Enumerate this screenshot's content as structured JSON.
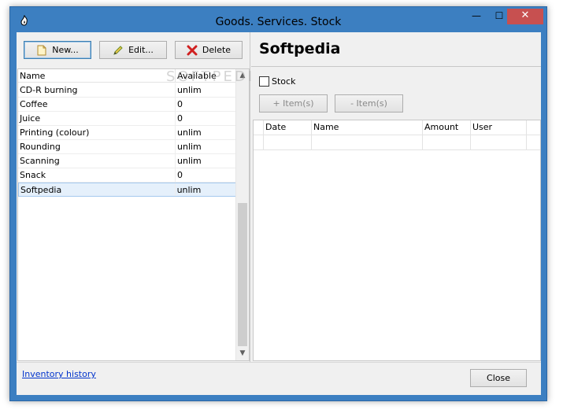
{
  "window": {
    "title": "Goods. Services. Stock",
    "minimize_glyph": "—",
    "maximize_glyph": "☐",
    "close_glyph": "✕"
  },
  "toolbar": {
    "new_label": "New...",
    "edit_label": "Edit...",
    "delete_label": "Delete"
  },
  "items_list": {
    "columns": [
      "Name",
      "Available"
    ],
    "rows": [
      {
        "name": "CD-R burning",
        "available": "unlim"
      },
      {
        "name": "Coffee",
        "available": "0"
      },
      {
        "name": "Juice",
        "available": "0"
      },
      {
        "name": "Printing (colour)",
        "available": "unlim"
      },
      {
        "name": "Rounding",
        "available": "unlim"
      },
      {
        "name": "Scanning",
        "available": "unlim"
      },
      {
        "name": "Snack",
        "available": "0"
      },
      {
        "name": "Softpedia",
        "available": "unlim"
      }
    ],
    "selected_index": 7
  },
  "details": {
    "title": "Softpedia",
    "stock_label": "Stock",
    "stock_checked": false,
    "add_items_label": "+ Item(s)",
    "remove_items_label": "- Item(s)",
    "grid_columns": [
      "Date",
      "Name",
      "Amount",
      "User"
    ]
  },
  "footer": {
    "history_link": "Inventory history",
    "close_label": "Close"
  },
  "watermark_text": "SOFTPEDIA",
  "colors": {
    "title_bar": "#3c7fc1",
    "close_button": "#c75050",
    "selection": "#e5f0fb",
    "link": "#0033cc"
  }
}
